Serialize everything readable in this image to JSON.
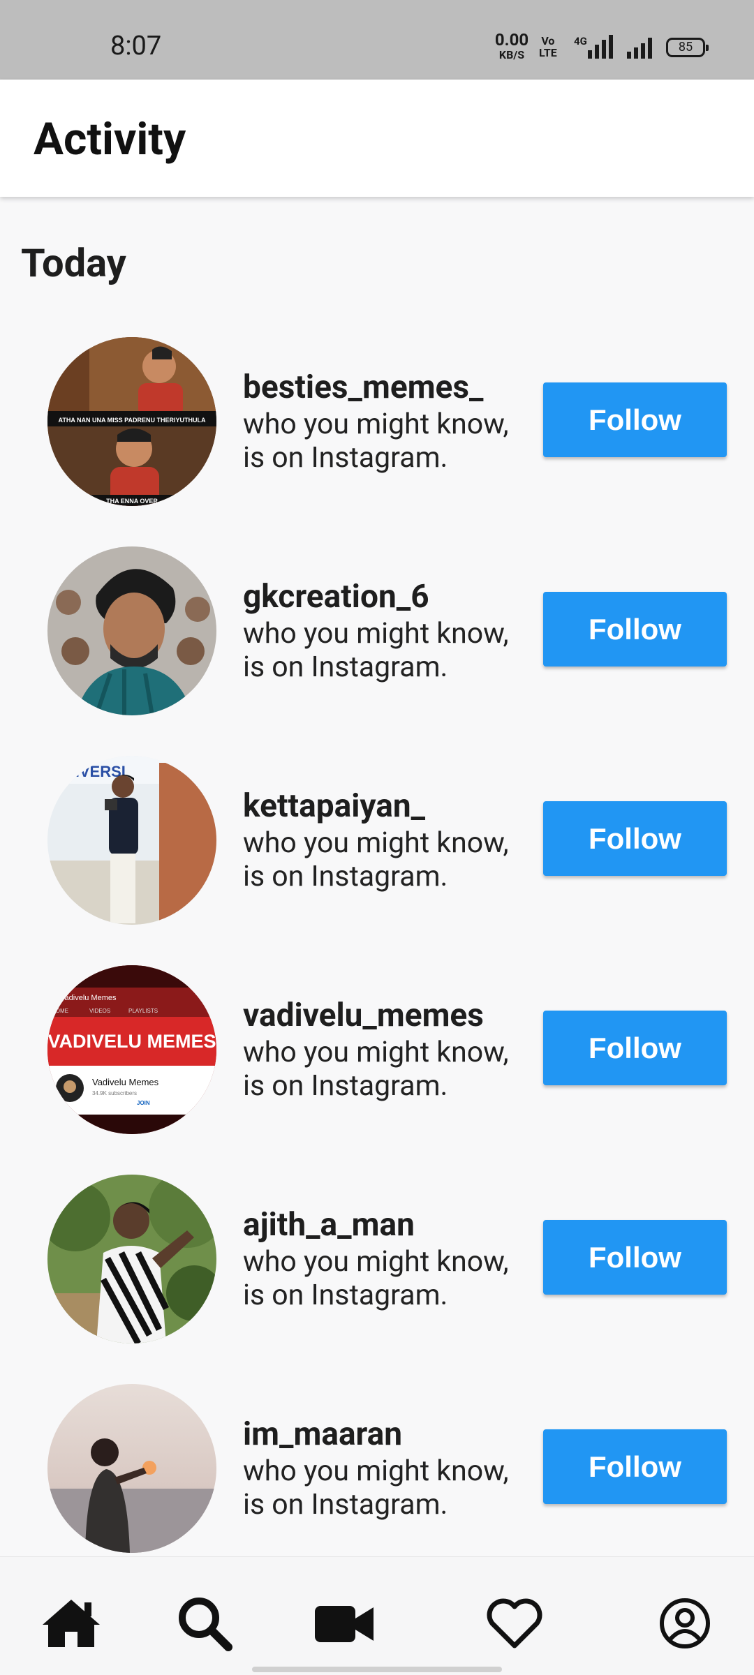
{
  "status_bar": {
    "time": "8:07",
    "net_speed_value": "0.00",
    "net_speed_unit": "KB/S",
    "volte_line1": "Vo",
    "volte_line2": "LTE",
    "network_type": "4G",
    "battery": "85"
  },
  "header": {
    "title": "Activity"
  },
  "section": {
    "title": "Today"
  },
  "suggestions": [
    {
      "username": "besties_memes_",
      "line1": "who you might know,",
      "line2": "is on Instagram.",
      "button": "Follow"
    },
    {
      "username": "gkcreation_6",
      "line1": "who you might know,",
      "line2": "is on Instagram.",
      "button": "Follow"
    },
    {
      "username": "kettapaiyan_",
      "line1": "who you might know,",
      "line2": "is on Instagram.",
      "button": "Follow"
    },
    {
      "username": "vadivelu_memes",
      "line1": "who you might know,",
      "line2": "is on Instagram.",
      "button": "Follow"
    },
    {
      "username": "ajith_a_man",
      "line1": "who you might know,",
      "line2": "is on Instagram.",
      "button": "Follow"
    },
    {
      "username": "im_maaran",
      "line1": "who you might know,",
      "line2": "is on Instagram.",
      "button": "Follow"
    }
  ],
  "avatar_text": {
    "besties_caption_top": "ATHA NAN UNA MISS PADRENU THERIYUTHULA",
    "besties_caption_bottom": "THA ENNA OVER",
    "vadivelu_banner": "VADIVELU MEMES",
    "vadivelu_channel": "Vadivelu Memes",
    "vadivelu_subs": "34.9K subscribers",
    "vadivelu_tab1": "HOME",
    "vadivelu_tab2": "VIDEOS",
    "vadivelu_tab3": "PLAYLISTS",
    "vadivelu_join": "JOIN"
  },
  "bottom_nav": {
    "items": [
      "home-icon",
      "search-icon",
      "video-camera-icon",
      "heart-icon",
      "profile-icon"
    ]
  },
  "colors": {
    "accent": "#2196f3",
    "background": "#f8f8f9",
    "status_bar": "#bdbdbd"
  }
}
